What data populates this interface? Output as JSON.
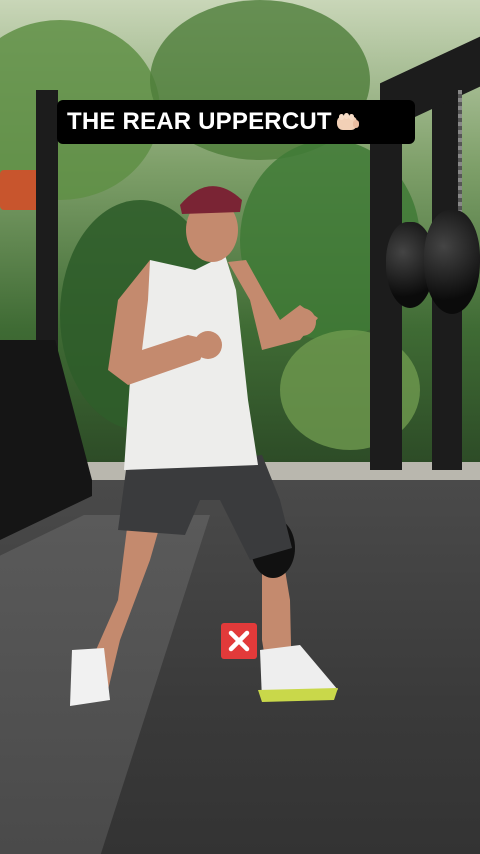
{
  "overlay": {
    "title": "THE REAR UPPERCUT",
    "title_emoji_icon": "fist-icon",
    "wrong_mark_icon": "cross-mark-icon",
    "wrong_mark_color": "#e23a3a"
  },
  "colors": {
    "banner_bg": "#000000",
    "banner_text": "#ffffff"
  }
}
